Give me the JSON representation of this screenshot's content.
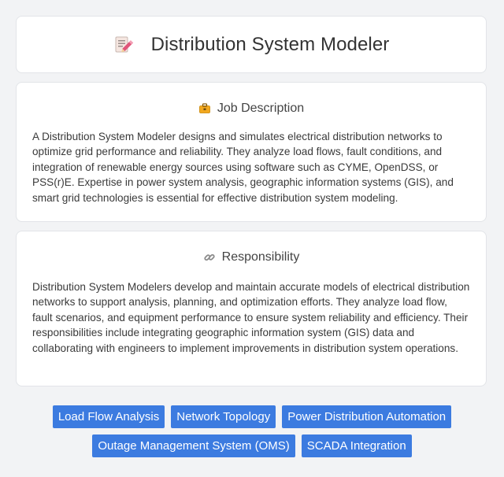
{
  "header": {
    "title": "Distribution System Modeler",
    "icon": "memo-pencil-icon"
  },
  "job_description": {
    "heading": "Job Description",
    "icon": "briefcase-icon",
    "text": "A Distribution System Modeler designs and simulates electrical distribution networks to optimize grid performance and reliability. They analyze load flows, fault conditions, and integration of renewable energy sources using software such as CYME, OpenDSS, or PSS(r)E. Expertise in power system analysis, geographic information systems (GIS), and smart grid technologies is essential for effective distribution system modeling."
  },
  "responsibility": {
    "heading": "Responsibility",
    "icon": "link-icon",
    "text": "Distribution System Modelers develop and maintain accurate models of electrical distribution networks to support analysis, planning, and optimization efforts. They analyze load flow, fault scenarios, and equipment performance to ensure system reliability and efficiency. Their responsibilities include integrating geographic information system (GIS) data and collaborating with engineers to implement improvements in distribution system operations."
  },
  "tags": [
    "Load Flow Analysis",
    "Network Topology",
    "Power Distribution Automation",
    "Outage Management System (OMS)",
    "SCADA Integration"
  ],
  "colors": {
    "tag_background": "#3c7be0",
    "page_background": "#f2f3f5"
  }
}
